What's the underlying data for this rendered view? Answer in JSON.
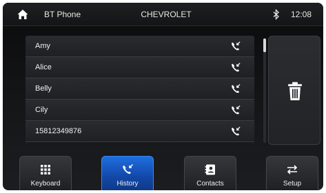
{
  "header": {
    "left_title": "BT Phone",
    "center_title": "CHEVROLET",
    "time": "12:08",
    "icons": [
      "home-icon",
      "bluetooth-icon"
    ]
  },
  "contacts": [
    {
      "name": "Amy"
    },
    {
      "name": "Alice"
    },
    {
      "name": "Belly"
    },
    {
      "name": "Cily"
    },
    {
      "name": "15812349876"
    }
  ],
  "delete_button": {
    "icon": "trash-icon"
  },
  "nav": [
    {
      "label": "Keyboard",
      "icon": "keypad-icon",
      "active": false
    },
    {
      "label": "History",
      "icon": "call-history-icon",
      "active": true
    },
    {
      "label": "Contacts",
      "icon": "contacts-icon",
      "active": false
    },
    {
      "label": "Setup",
      "icon": "settings-icon",
      "active": false
    }
  ],
  "colors": {
    "active_tab": "#1f6ee0",
    "background": "#151618",
    "text": "#f2f2f2"
  }
}
